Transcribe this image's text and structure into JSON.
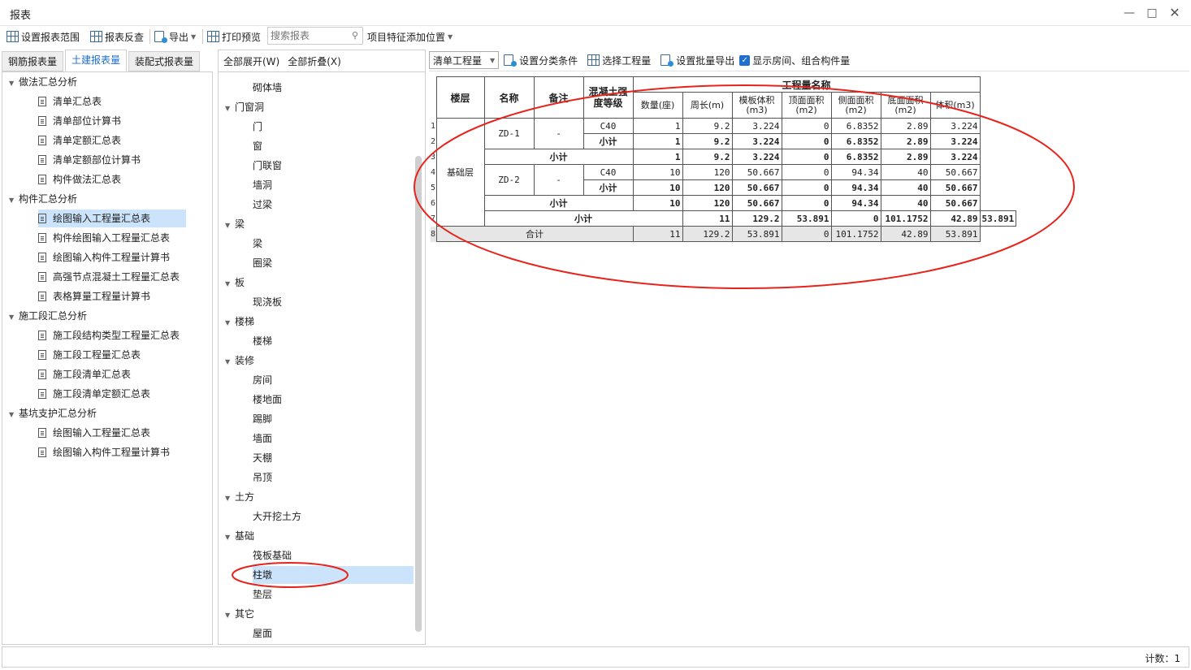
{
  "window": {
    "title": "报表"
  },
  "toolbar": {
    "set_range": "设置报表范围",
    "reverse": "报表反查",
    "export": "导出",
    "print_preview": "打印预览",
    "search_placeholder": "搜索报表",
    "feature_position": "项目特征添加位置"
  },
  "tabs": [
    "钢筋报表量",
    "土建报表量",
    "装配式报表量"
  ],
  "left_tree": [
    {
      "label": "做法汇总分析",
      "level": 0
    },
    {
      "label": "清单汇总表",
      "level": 1
    },
    {
      "label": "清单部位计算书",
      "level": 1
    },
    {
      "label": "清单定额汇总表",
      "level": 1
    },
    {
      "label": "清单定额部位计算书",
      "level": 1
    },
    {
      "label": "构件做法汇总表",
      "level": 1
    },
    {
      "label": "构件汇总分析",
      "level": 0
    },
    {
      "label": "绘图输入工程量汇总表",
      "level": 1,
      "selected": true
    },
    {
      "label": "构件绘图输入工程量汇总表",
      "level": 1
    },
    {
      "label": "绘图输入构件工程量计算书",
      "level": 1
    },
    {
      "label": "高强节点混凝土工程量汇总表",
      "level": 1
    },
    {
      "label": "表格算量工程量计算书",
      "level": 1
    },
    {
      "label": "施工段汇总分析",
      "level": 0
    },
    {
      "label": "施工段结构类型工程量汇总表",
      "level": 1
    },
    {
      "label": "施工段工程量汇总表",
      "level": 1
    },
    {
      "label": "施工段清单汇总表",
      "level": 1
    },
    {
      "label": "施工段清单定额汇总表",
      "level": 1
    },
    {
      "label": "基坑支护汇总分析",
      "level": 0
    },
    {
      "label": "绘图输入工程量汇总表",
      "level": 1
    },
    {
      "label": "绘图输入构件工程量计算书",
      "level": 1
    }
  ],
  "mid_bar": {
    "expand_all": "全部展开(W)",
    "collapse_all": "全部折叠(X)"
  },
  "mid_tree": [
    {
      "label": "砌体墙",
      "level": 1
    },
    {
      "label": "门窗洞",
      "level": 0
    },
    {
      "label": "门",
      "level": 1
    },
    {
      "label": "窗",
      "level": 1
    },
    {
      "label": "门联窗",
      "level": 1
    },
    {
      "label": "墙洞",
      "level": 1
    },
    {
      "label": "过梁",
      "level": 1
    },
    {
      "label": "梁",
      "level": 0
    },
    {
      "label": "梁",
      "level": 1
    },
    {
      "label": "圈梁",
      "level": 1
    },
    {
      "label": "板",
      "level": 0
    },
    {
      "label": "现浇板",
      "level": 1
    },
    {
      "label": "楼梯",
      "level": 0
    },
    {
      "label": "楼梯",
      "level": 1
    },
    {
      "label": "装修",
      "level": 0
    },
    {
      "label": "房间",
      "level": 1
    },
    {
      "label": "楼地面",
      "level": 1
    },
    {
      "label": "踢脚",
      "level": 1
    },
    {
      "label": "墙面",
      "level": 1
    },
    {
      "label": "天棚",
      "level": 1
    },
    {
      "label": "吊顶",
      "level": 1
    },
    {
      "label": "土方",
      "level": 0
    },
    {
      "label": "大开挖土方",
      "level": 1
    },
    {
      "label": "基础",
      "level": 0
    },
    {
      "label": "筏板基础",
      "level": 1
    },
    {
      "label": "柱墩",
      "level": 1,
      "selected": true
    },
    {
      "label": "垫层",
      "level": 1
    },
    {
      "label": "其它",
      "level": 0
    },
    {
      "label": "屋面",
      "level": 1
    }
  ],
  "right_bar": {
    "dropdown": "清单工程量",
    "set_category": "设置分类条件",
    "select_qty": "选择工程量",
    "batch_export": "设置批量导出",
    "show_rooms": "显示房间、组合构件量"
  },
  "table": {
    "h_floor": "楼层",
    "h_name": "名称",
    "h_remark": "备注",
    "h_grade": "混凝土强度等级",
    "h_group": "工程量名称",
    "h_cols": [
      "数量(座)",
      "周长(m)",
      "模板体积(m3)",
      "顶面面积(m2)",
      "侧面面积(m2)",
      "底面面积(m2)",
      "体积(m3)"
    ],
    "floor": "基础层",
    "name1": "ZD-1",
    "name2": "ZD-2",
    "dash": "-",
    "grade": "C40",
    "subtotal": "小计",
    "total": "合计",
    "rows": [
      [
        "1",
        "9.2",
        "3.224",
        "0",
        "6.8352",
        "2.89",
        "3.224"
      ],
      [
        "1",
        "9.2",
        "3.224",
        "0",
        "6.8352",
        "2.89",
        "3.224"
      ],
      [
        "1",
        "9.2",
        "3.224",
        "0",
        "6.8352",
        "2.89",
        "3.224"
      ],
      [
        "10",
        "120",
        "50.667",
        "0",
        "94.34",
        "40",
        "50.667"
      ],
      [
        "10",
        "120",
        "50.667",
        "0",
        "94.34",
        "40",
        "50.667"
      ],
      [
        "10",
        "120",
        "50.667",
        "0",
        "94.34",
        "40",
        "50.667"
      ],
      [
        "11",
        "129.2",
        "53.891",
        "0",
        "101.1752",
        "42.89",
        "53.891"
      ],
      [
        "11",
        "129.2",
        "53.891",
        "0",
        "101.1752",
        "42.89",
        "53.891"
      ]
    ],
    "row_numbers": [
      "1",
      "2",
      "3",
      "4",
      "5",
      "6",
      "7",
      "8"
    ]
  },
  "status": {
    "count": "计数：1"
  },
  "annotation_color": "#e8231b"
}
